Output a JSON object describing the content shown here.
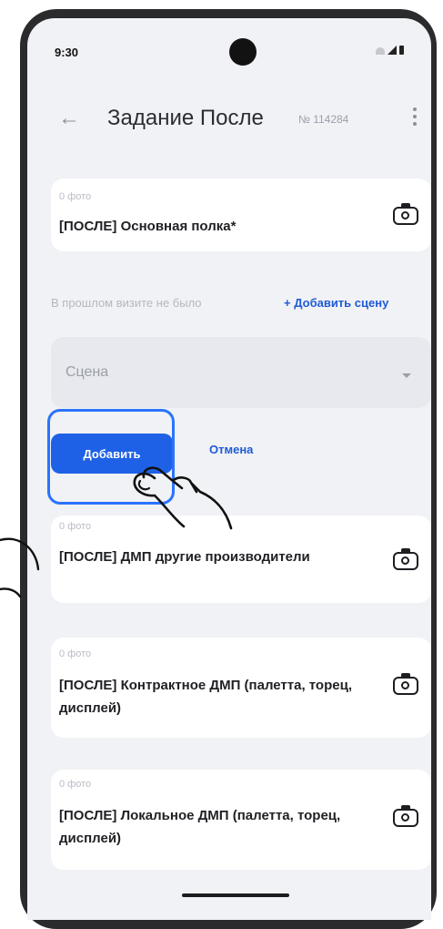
{
  "status_bar": {
    "time": "9:30"
  },
  "header": {
    "title": "Задание После",
    "task_number": "№ 114284"
  },
  "cards": [
    {
      "photo_count": "0 фото",
      "title": "[ПОСЛЕ] Основная полка*"
    },
    {
      "photo_count": "0 фото",
      "title": "[ПОСЛЕ] ДМП другие производители"
    },
    {
      "photo_count": "0 фото",
      "title": "[ПОСЛЕ] Контрактное ДМП (палетта, торец, дисплей)"
    },
    {
      "photo_count": "0 фото",
      "title": "[ПОСЛЕ] Локальное ДМП (палетта, торец, дисплей)"
    }
  ],
  "previous_visit": {
    "text": "В прошлом визите не было",
    "add_scene_label": "+ Добавить сцену"
  },
  "scene_select": {
    "label": "Сцена"
  },
  "actions": {
    "add_label": "Добавить",
    "cancel_label": "Отмена"
  },
  "colors": {
    "accent": "#1f61e6",
    "link": "#1e5ad7",
    "highlight": "#2a73ff",
    "background": "#f1f2f5"
  }
}
